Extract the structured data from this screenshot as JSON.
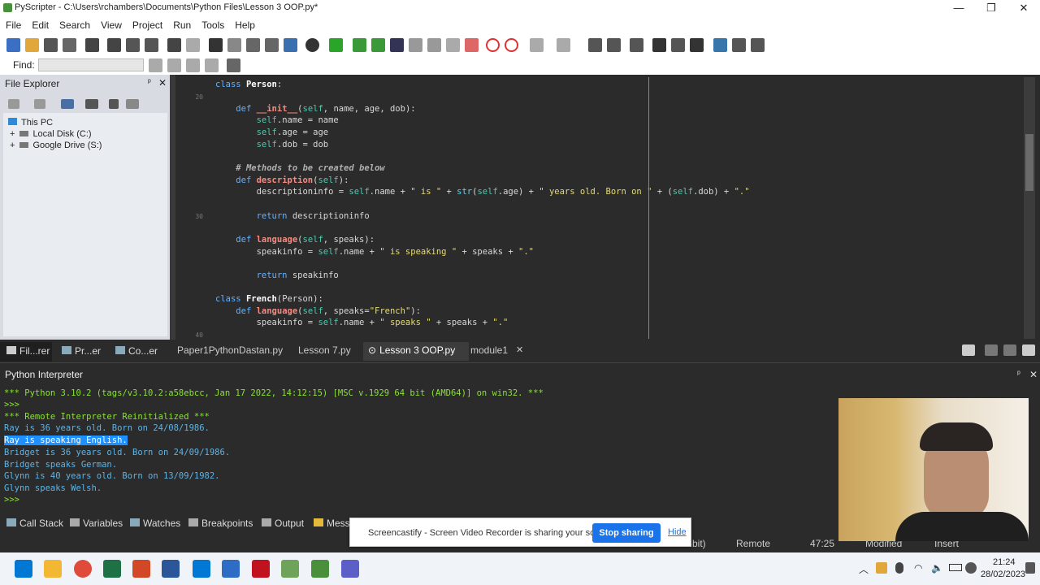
{
  "window": {
    "title": "PyScripter - C:\\Users\\rchambers\\Documents\\Python Files\\Lesson 3 OOP.py*",
    "minimize": "—",
    "maximize": "❐",
    "close": "✕"
  },
  "menu": [
    "File",
    "Edit",
    "Search",
    "View",
    "Project",
    "Run",
    "Tools",
    "Help"
  ],
  "find": {
    "label": "Find:"
  },
  "explorer": {
    "title": "File Explorer",
    "pin": "ᵖ",
    "close": "✕",
    "tree": [
      "This PC",
      "Local Disk (C:)",
      "Google Drive (S:)"
    ]
  },
  "editor": {
    "line_numbers": [
      "20",
      "30",
      "40"
    ]
  },
  "left_tabs": [
    "Fil...rer",
    "Pr...er",
    "Co...er"
  ],
  "editor_tabs": [
    "Paper1PythonDastan.py",
    "Lesson 7.py",
    "Lesson 3 OOP.py",
    "module1"
  ],
  "interpreter": {
    "title": "Python Interpreter",
    "lines": [
      "*** Python 3.10.2 (tags/v3.10.2:a58ebcc, Jan 17 2022, 14:12:15) [MSC v.1929 64 bit (AMD64)] on win32. ***",
      ">>>",
      "*** Remote Interpreter Reinitialized ***",
      "Ray is 36 years old. Born on 24/08/1986.",
      "Ray is speaking English.",
      "Bridget is 36 years old. Born on 24/09/1986.",
      "Bridget speaks German.",
      "Glynn is 40 years old. Born on 13/09/1982.",
      "Glynn speaks Welsh.",
      ">>>"
    ]
  },
  "bottom_tabs": [
    "Call Stack",
    "Variables",
    "Watches",
    "Breakpoints",
    "Output",
    "Mess"
  ],
  "status": {
    "bits": "-bit)",
    "remote": "Remote",
    "position": "47:25",
    "modified": "Modified",
    "insert": "Insert"
  },
  "notice": {
    "message": "Screencastify - Screen Video Recorder is sharing your screen.",
    "stop": "Stop sharing",
    "hide": "Hide"
  },
  "clock": {
    "time": "21:24",
    "date": "28/02/2023"
  },
  "colors": {
    "editor_bg": "#2b2b2b",
    "keyword": "#66b2ff",
    "function": "#f28b82",
    "string": "#e6db74",
    "self": "#4ec9b0",
    "output_blue": "#5fb3e6",
    "output_green": "#8ae234",
    "selection": "#1e90ff"
  }
}
